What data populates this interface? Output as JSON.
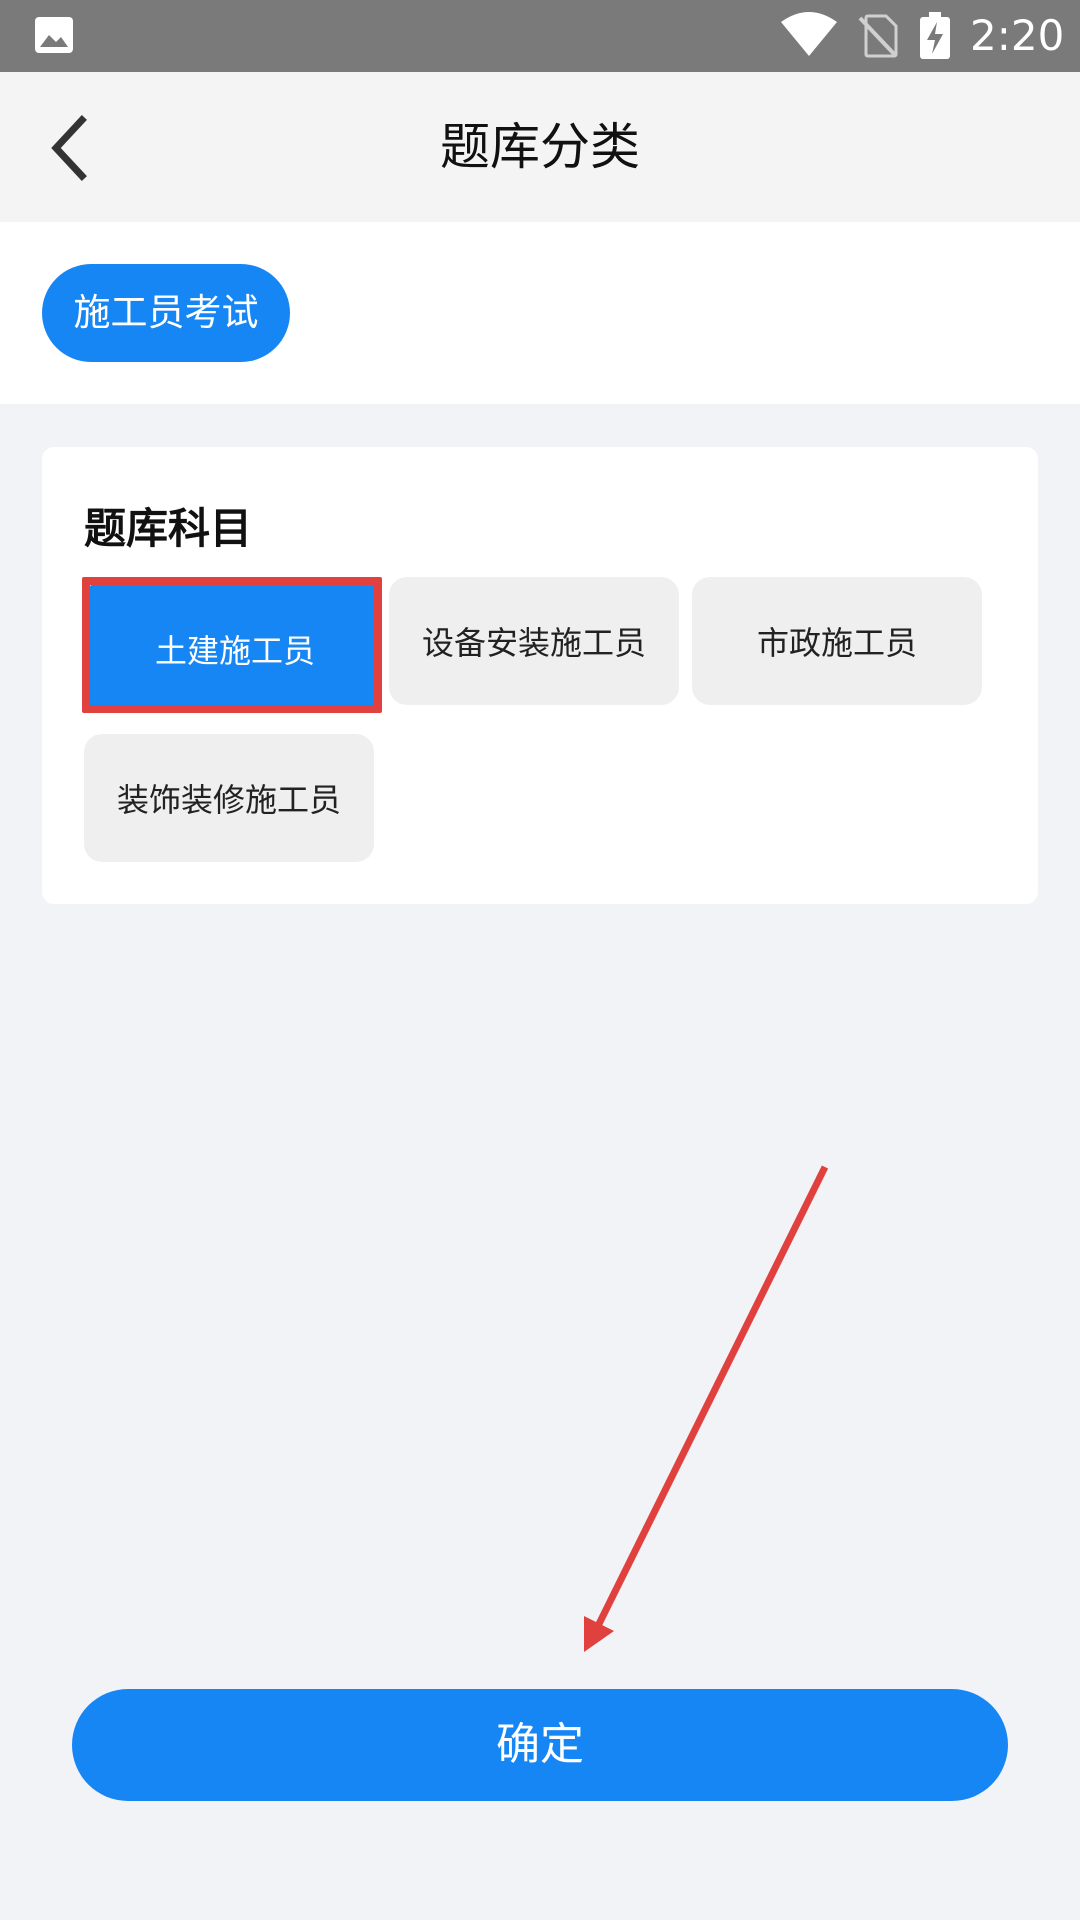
{
  "status_bar": {
    "time": "2:20",
    "icons": [
      "gallery-icon",
      "wifi-icon",
      "no-sim-icon",
      "battery-charging-icon"
    ]
  },
  "nav": {
    "back_icon": "chevron-left-icon",
    "title": "题库分类"
  },
  "exam_category": {
    "selected_label": "施工员考试"
  },
  "subject_card": {
    "title": "题库科目",
    "options": [
      {
        "label": "土建施工员",
        "selected": true
      },
      {
        "label": "设备安装施工员",
        "selected": false
      },
      {
        "label": "市政施工员",
        "selected": false
      },
      {
        "label": "装饰装修施工员",
        "selected": false
      }
    ]
  },
  "confirm": {
    "label": "确定"
  },
  "colors": {
    "accent": "#1686f5",
    "annotation": "#e0413f",
    "status_bar": "#7a7a7a",
    "page_background": "#f1f3f6",
    "option_background": "#efefef"
  }
}
